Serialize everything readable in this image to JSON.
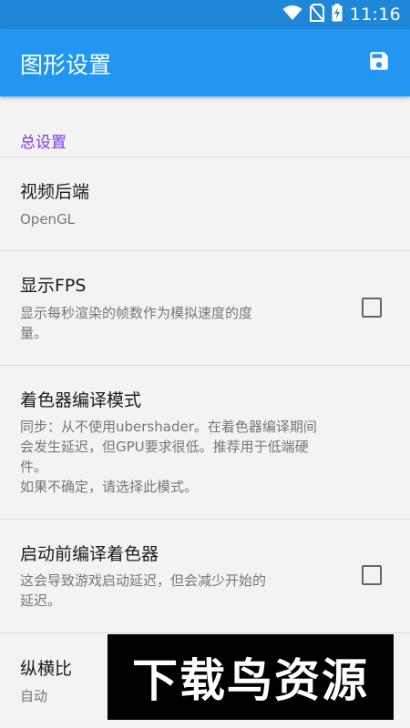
{
  "status_bar": {
    "time": "11:16"
  },
  "app_bar": {
    "title": "图形设置",
    "save_icon": "save-icon"
  },
  "section": {
    "header": "总设置"
  },
  "preferences": [
    {
      "title": "视频后端",
      "summary": "OpenGL"
    },
    {
      "title": "显示FPS",
      "summary": "显示每秒渲染的帧数作为模拟速度的度\n量。",
      "checked": false
    },
    {
      "title": "着色器编译模式",
      "summary": "同步：从不使用ubershader。在着色器编译期间\n会发生延迟，但GPU要求很低。推荐用于低端硬\n件。\n如果不确定，请选择此模式。"
    },
    {
      "title": "启动前编译着色器",
      "summary": "这会导致游戏启动延迟，但会减少开始的\n延迟。",
      "checked": false
    },
    {
      "title": "纵横比",
      "summary": "自动"
    }
  ],
  "watermark": {
    "text": "下载鸟资源"
  },
  "colors": {
    "status_bar": "#1f87d8",
    "app_bar": "#2196f3",
    "section_header": "#7c3aed"
  }
}
